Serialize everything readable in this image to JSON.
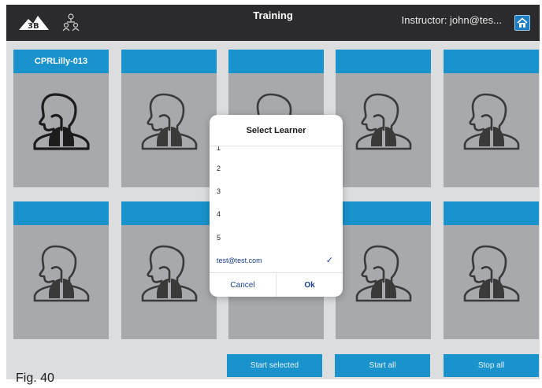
{
  "header": {
    "title": "Training",
    "instructor": "Instructor: john@tes...",
    "logo_icon": "brand-logo",
    "network_icon": "network-icon",
    "home_icon": "home-icon"
  },
  "cards": [
    {
      "label": "CPRLilly-013",
      "icon": "torso-lungs-icon",
      "active": true
    },
    {
      "label": "",
      "icon": "torso-lungs-icon",
      "active": false
    },
    {
      "label": "",
      "icon": "torso-lungs-icon",
      "active": false
    },
    {
      "label": "",
      "icon": "torso-lungs-icon",
      "active": false
    },
    {
      "label": "",
      "icon": "torso-lungs-icon",
      "active": false
    },
    {
      "label": "",
      "icon": "torso-lungs-icon",
      "active": false
    },
    {
      "label": "",
      "icon": "torso-lungs-icon",
      "active": false
    },
    {
      "label": "",
      "icon": "torso-lungs-icon",
      "active": false
    },
    {
      "label": "",
      "icon": "torso-lungs-icon",
      "active": false
    },
    {
      "label": "",
      "icon": "torso-lungs-icon",
      "active": false
    }
  ],
  "actions": {
    "start_selected": "Start selected",
    "start_all": "Start all",
    "stop_all": "Stop all"
  },
  "dialog": {
    "title": "Select Learner",
    "options": [
      "1",
      "2",
      "3",
      "4",
      "5",
      "test@test.com"
    ],
    "selected": "test@test.com",
    "cancel": "Cancel",
    "ok": "Ok"
  },
  "colors": {
    "accent": "#1a92cc",
    "topbar": "#2b2b2d",
    "card": "#a7a9ac",
    "background": "#dcdddf",
    "dialog_text": "#1a3f8f"
  },
  "caption": "Fig. 40"
}
